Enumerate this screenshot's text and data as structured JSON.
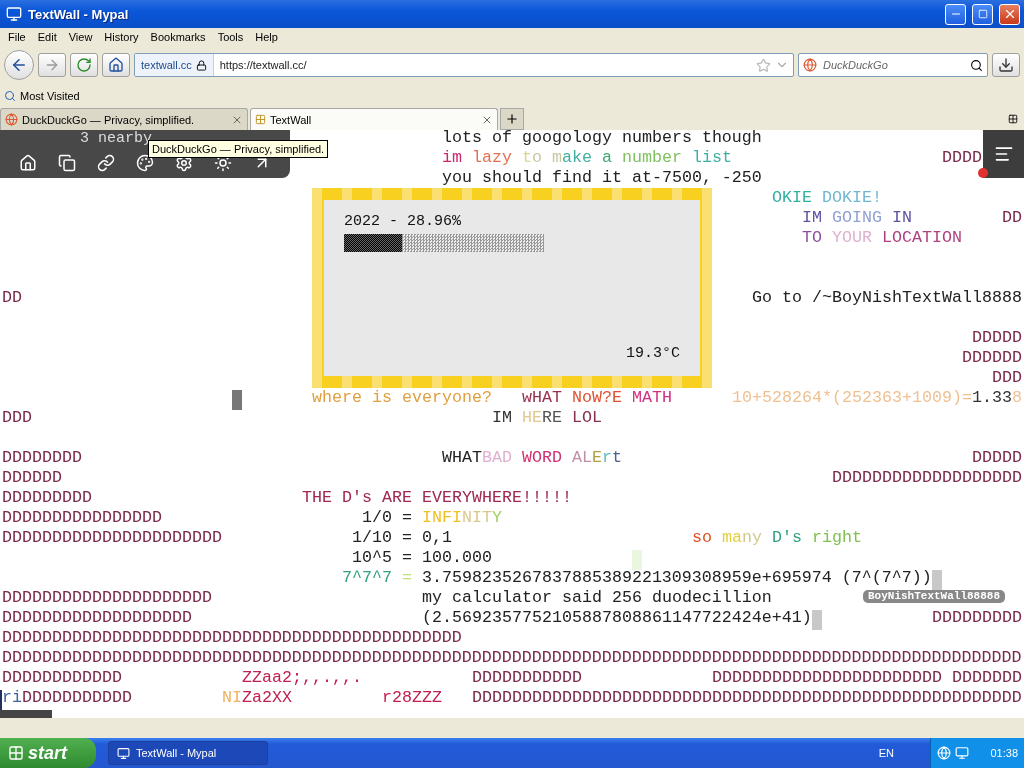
{
  "window": {
    "title": "TextWall - Mypal"
  },
  "menu": [
    "File",
    "Edit",
    "View",
    "History",
    "Bookmarks",
    "Tools",
    "Help"
  ],
  "nav": {
    "site_label": "textwall.cc",
    "url": "https://textwall.cc/",
    "search_placeholder": "DuckDuckGo"
  },
  "bookmarks": [
    "Most Visited"
  ],
  "tabs": [
    {
      "label": "DuckDuckGo — Privacy, simplified.",
      "selected": false
    },
    {
      "label": "TextWall",
      "selected": true
    }
  ],
  "wall": {
    "nearby": "3 nearby",
    "tooltip": "DuckDuckGo — Privacy, simplified.",
    "widget": {
      "title": "2022 - 28.96%",
      "level": 0.2896,
      "temperature": "19.3°C"
    },
    "cursor_label": "BoyNishTextWall88888",
    "lines": [
      {
        "pieces": [
          {
            "spans": [
              {
                "text": "lots of googology numbers though",
                "color": "#222222"
              }
            ]
          }
        ]
      },
      {
        "pieces": [
          {
            "spans": [
              {
                "text": "im ",
                "color": "#c8286a"
              },
              {
                "text": "lazy ",
                "color": "#e07050"
              },
              {
                "text": "t",
                "color": "#d8d890"
              },
              {
                "text": "o m",
                "color": "#c8c8a0"
              },
              {
                "text": "ake ",
                "color": "#40b0a0"
              },
              {
                "text": "a ",
                "color": "#40a870"
              },
              {
                "text": "number ",
                "color": "#80c060"
              },
              {
                "text": "list",
                "color": "#40b0a0"
              }
            ]
          },
          {
            "spans": [
              {
                "text": "DDDD",
                "color": "#7a2a4c"
              }
            ]
          }
        ]
      },
      {
        "pieces": [
          {
            "spans": [
              {
                "text": "you should find it at-7500, -250",
                "color": "#222222"
              }
            ]
          }
        ]
      },
      {
        "pieces": [
          {
            "spans": [
              {
                "text": "OKIE ",
                "color": "#30b0a0"
              },
              {
                "text": "DOKIE!",
                "color": "#70b8d0"
              }
            ]
          }
        ]
      },
      {
        "pieces": [
          {
            "spans": [
              {
                "text": "IM ",
                "color": "#6050a0"
              },
              {
                "text": "GOING ",
                "color": "#90a0d0"
              },
              {
                "text": "IN",
                "color": "#6050a0"
              }
            ]
          },
          {
            "spans": [
              {
                "text": "DD",
                "color": "#7a2a4c"
              }
            ]
          }
        ]
      },
      {
        "pieces": [
          {
            "spans": [
              {
                "text": "TO ",
                "color": "#9050a0"
              },
              {
                "text": "YOUR ",
                "color": "#e0b0d0"
              },
              {
                "text": "LOCATION",
                "color": "#b04080"
              }
            ]
          }
        ]
      },
      {
        "pieces": [
          {
            "spans": [
              {
                "text": "DD",
                "color": "#7a2a4c"
              }
            ]
          },
          {
            "spans": [
              {
                "text": "Go to /~BoyNishTextWall8888",
                "color": "#222222"
              }
            ]
          }
        ]
      },
      {
        "pieces": [
          {
            "spans": [
              {
                "text": "DDDDD",
                "color": "#7a2a4c"
              }
            ]
          }
        ]
      },
      {
        "pieces": [
          {
            "spans": [
              {
                "text": "DDDDDD",
                "color": "#7a2a4c"
              }
            ]
          }
        ]
      },
      {
        "pieces": [
          {
            "spans": [
              {
                "text": "DDD",
                "color": "#7a2a4c"
              }
            ]
          }
        ]
      },
      {
        "pieces": [
          {
            "spans": [
              {
                "text": "where is everyone?",
                "color": "#e0a040"
              }
            ]
          },
          {
            "spans": [
              {
                "text": "wHAT ",
                "color": "#9a3050"
              },
              {
                "text": "NoW?E ",
                "color": "#e05030"
              },
              {
                "text": "MATH",
                "color": "#d03080"
              }
            ]
          },
          {
            "spans": [
              {
                "text": "10+528264*(252363+1009)=",
                "color": "#f0c090"
              },
              {
                "text": "1.33",
                "color": "#333333"
              },
              {
                "text": "8",
                "color": "#f0c090"
              }
            ]
          }
        ]
      },
      {
        "pieces": [
          {
            "spans": [
              {
                "text": "DDD",
                "color": "#7a2a4c"
              }
            ]
          },
          {
            "spans": [
              {
                "text": "IM ",
                "color": "#333333"
              },
              {
                "text": "HE",
                "color": "#e0c890"
              },
              {
                "text": "RE ",
                "color": "#555555"
              },
              {
                "text": "LOL",
                "color": "#8a3050"
              }
            ]
          }
        ]
      },
      {
        "pieces": [
          {
            "spans": [
              {
                "text": "DDDDDDDD",
                "color": "#7a2a4c"
              }
            ]
          },
          {
            "spans": [
              {
                "text": "WHAT",
                "color": "#222222"
              },
              {
                "text": "BAD ",
                "color": "#e0b0d0"
              },
              {
                "text": "WORD ",
                "color": "#d03070"
              },
              {
                "text": "AL",
                "color": "#c090a8"
              },
              {
                "text": "E",
                "color": "#b0a040"
              },
              {
                "text": "r",
                "color": "#60c0c0"
              },
              {
                "text": "t",
                "color": "#506090"
              }
            ]
          },
          {
            "spans": [
              {
                "text": "DDDDD",
                "color": "#7a2a4c"
              }
            ]
          }
        ]
      },
      {
        "pieces": [
          {
            "spans": [
              {
                "text": "DDDDDD",
                "color": "#7a2a4c"
              }
            ]
          },
          {
            "spans": [
              {
                "text": "DDDDDDDDDDDDDDDDDDD",
                "color": "#7a2a4c"
              }
            ]
          }
        ]
      },
      {
        "pieces": [
          {
            "spans": [
              {
                "text": "DDDDDDDDD",
                "color": "#7a2a4c"
              }
            ]
          },
          {
            "spans": [
              {
                "text": "THE D's ARE EVERYWHERE!!!!!",
                "color": "#a02850"
              }
            ]
          }
        ]
      },
      {
        "pieces": [
          {
            "spans": [
              {
                "text": "DDDDDDDDDDDDDDDD",
                "color": "#7a2a4c"
              }
            ]
          },
          {
            "spans": [
              {
                "text": "1/0 = ",
                "color": "#222222"
              },
              {
                "text": "INFI",
                "color": "#f0c020"
              },
              {
                "text": "NIT",
                "color": "#d8c890"
              },
              {
                "text": "Y",
                "color": "#a0d060"
              }
            ]
          }
        ]
      },
      {
        "pieces": [
          {
            "spans": [
              {
                "text": "DDDDDDDDDDDDDDDDDDDDDD",
                "color": "#7a2a4c"
              }
            ]
          },
          {
            "spans": [
              {
                "text": "1/10 = 0,1",
                "color": "#222222"
              }
            ]
          },
          {
            "spans": [
              {
                "text": "so ",
                "color": "#e05020"
              },
              {
                "text": "ma",
                "color": "#e0d040"
              },
              {
                "text": "ny ",
                "color": "#d0c890"
              },
              {
                "text": "D's ",
                "color": "#30a080"
              },
              {
                "text": "right",
                "color": "#80c050"
              }
            ]
          }
        ]
      },
      {
        "pieces": [
          {
            "spans": [
              {
                "text": "10^5 = 100.000",
                "color": "#222222"
              }
            ]
          }
        ]
      },
      {
        "pieces": [
          {
            "spans": [
              {
                "text": "7^7^7 ",
                "color": "#30a080"
              },
              {
                "text": "= ",
                "color": "#c0e080"
              },
              {
                "text": "3.7598235267837885389221309308959e+695974 (7^(7^7))",
                "color": "#222222"
              }
            ]
          }
        ]
      },
      {
        "pieces": [
          {
            "spans": [
              {
                "text": "DDDDDDDDDDDDDDDDDDDDD",
                "color": "#7a2a4c"
              }
            ]
          },
          {
            "spans": [
              {
                "text": "my calculator said 256 duodecillion",
                "color": "#222222"
              }
            ]
          }
        ]
      },
      {
        "pieces": [
          {
            "spans": [
              {
                "text": "DDDDDDDDDDDDDDDDDDD",
                "color": "#7a2a4c"
              }
            ]
          },
          {
            "spans": [
              {
                "text": "(2.5692357752105887808861147722424e+41)",
                "color": "#222222"
              }
            ]
          },
          {
            "spans": [
              {
                "text": "DDDDDDDDD",
                "color": "#7a2a4c"
              }
            ]
          }
        ]
      },
      {
        "pieces": [
          {
            "spans": [
              {
                "text": "DDDDDDDDDDDDDDDDDDDDDDDDDDDDDDDDDDDDDDDDDDDDDD",
                "color": "#7a2a4c"
              }
            ]
          }
        ]
      },
      {
        "pieces": [
          {
            "spans": [
              {
                "text": "DDDDDDDDDDDDDDDDDDDDDDDDDDDDDDDDDDDDDDDDDDDDDDDDDDDDDDDDDDDDDDDDDDDDDDDDDDDDDDDDDDDDDDDDDDDDDDDDDDDDDD",
                "color": "#7a2a4c"
              }
            ]
          }
        ]
      },
      {
        "pieces": [
          {
            "spans": [
              {
                "text": "DDDDDDDDDDDD",
                "color": "#7a2a4c"
              }
            ]
          },
          {
            "spans": [
              {
                "text": "ZZaa2;,,.,,.",
                "color": "#c02050"
              }
            ]
          },
          {
            "spans": [
              {
                "text": "DDDDDDDDDDD",
                "color": "#7a2a4c"
              }
            ]
          },
          {
            "spans": [
              {
                "text": "DDDDDDDDDDDDDDDDDDDDDDD",
                "color": "#7a2a4c"
              }
            ]
          },
          {
            "spans": [
              {
                "text": "DDDDDDD",
                "color": "#7a2a4c"
              }
            ]
          }
        ]
      },
      {
        "pieces": [
          {
            "spans": [
              {
                "text": "ri",
                "color": "#4060a0"
              },
              {
                "text": "DDDDDDDDDDD",
                "color": "#7a2a4c"
              }
            ]
          },
          {
            "spans": [
              {
                "text": "NI",
                "color": "#f0b060"
              },
              {
                "text": "Za2XX",
                "color": "#c02050"
              }
            ]
          },
          {
            "spans": [
              {
                "text": "r28ZZZ",
                "color": "#c02050"
              }
            ]
          },
          {
            "spans": [
              {
                "text": "DDDDDDDDDDDDDDDDDDDDDDDDDDDDDDDDDDDDDDDDDDDDDDDDDDDDDDD",
                "color": "#7a2a4c"
              }
            ]
          }
        ]
      }
    ]
  },
  "taskbar": {
    "start": "start",
    "tasks": [
      {
        "label": "TextWall - Mypal",
        "selected": true
      }
    ],
    "language": "EN",
    "clock": "01:38"
  }
}
